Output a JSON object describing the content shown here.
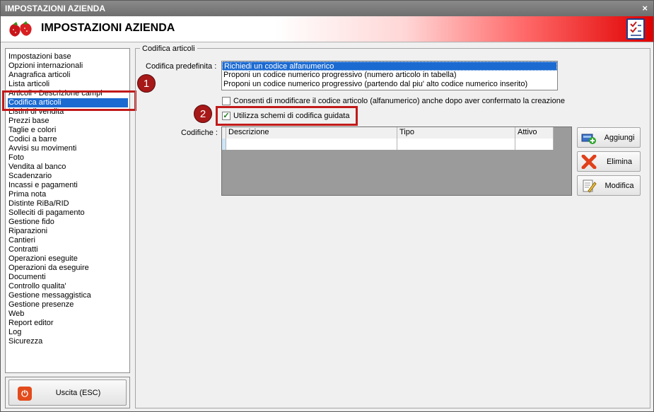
{
  "window": {
    "title": "IMPOSTAZIONI AZIENDA",
    "close_glyph": "×"
  },
  "banner": {
    "title": "IMPOSTAZIONI AZIENDA",
    "logo_icon": "strawberry-icon",
    "right_icon": "checklist-icon"
  },
  "sidebar": {
    "items": [
      {
        "label": "Impostazioni base"
      },
      {
        "label": "Opzioni internazionali"
      },
      {
        "label": "Anagrafica articoli"
      },
      {
        "label": "Lista articoli"
      },
      {
        "label": "Articoli - Descrizione campi"
      },
      {
        "label": "Codifica articoli",
        "selected": true
      },
      {
        "label": "Listini di vendita"
      },
      {
        "label": "Prezzi base"
      },
      {
        "label": "Taglie e colori"
      },
      {
        "label": "Codici a barre"
      },
      {
        "label": "Avvisi su movimenti"
      },
      {
        "label": "Foto"
      },
      {
        "label": "Vendita al banco"
      },
      {
        "label": "Scadenzario"
      },
      {
        "label": "Incassi e pagamenti"
      },
      {
        "label": "Prima nota"
      },
      {
        "label": "Distinte RiBa/RID"
      },
      {
        "label": "Solleciti di pagamento"
      },
      {
        "label": "Gestione fido"
      },
      {
        "label": "Riparazioni"
      },
      {
        "label": "Cantieri"
      },
      {
        "label": "Contratti"
      },
      {
        "label": "Operazioni eseguite"
      },
      {
        "label": "Operazioni da eseguire"
      },
      {
        "label": "Documenti"
      },
      {
        "label": "Controllo qualita'"
      },
      {
        "label": "Gestione messaggistica"
      },
      {
        "label": "Gestione presenze"
      },
      {
        "label": "Web"
      },
      {
        "label": "Report editor"
      },
      {
        "label": "Log"
      },
      {
        "label": "Sicurezza"
      }
    ]
  },
  "exit": {
    "label": "Uscita (ESC)",
    "icon": "power-icon"
  },
  "callouts": {
    "one": "1",
    "two": "2"
  },
  "group": {
    "title": "Codifica articoli"
  },
  "form": {
    "predefinita_label": "Codifica predefinita :",
    "options": [
      "Richiedi un codice alfanumerico",
      "Proponi un codice numerico progressivo (numero articolo in tabella)",
      "Proponi un codice numerico progressivo (partendo dal piu' alto codice numerico inserito)"
    ],
    "selected_option": 0,
    "consenti_label": "Consenti di modificare il codice articolo (alfanumerico) anche dopo aver confermato la creazione",
    "consenti_checked": false,
    "schemi_label": "Utilizza schemi di codifica guidata",
    "schemi_checked": true,
    "codifiche_label": "Codifiche :",
    "check_glyph": "✓"
  },
  "table": {
    "columns": [
      "Descrizione",
      "Tipo",
      "Attivo"
    ],
    "rows": [
      [
        "",
        "",
        ""
      ]
    ]
  },
  "buttons": {
    "aggiungi": "Aggiungi",
    "elimina": "Elimina",
    "modifica": "Modifica"
  }
}
